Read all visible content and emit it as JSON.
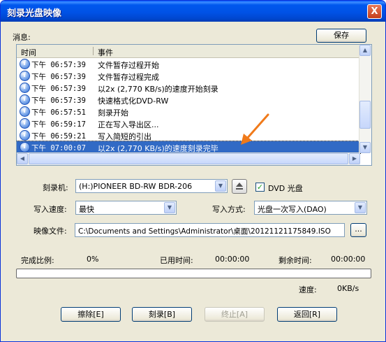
{
  "window": {
    "title": "刻录光盘映像",
    "close_label": "X"
  },
  "messages": {
    "label": "消息:",
    "save_button": "保存",
    "columns": {
      "time": "时间",
      "event": "事件"
    },
    "rows": [
      {
        "time": "下午 06:57:39",
        "event": "文件暂存过程开始"
      },
      {
        "time": "下午 06:57:39",
        "event": "文件暂存过程完成"
      },
      {
        "time": "下午 06:57:39",
        "event": "以2x (2,770 KB/s)的速度开始刻录"
      },
      {
        "time": "下午 06:57:39",
        "event": "快速格式化DVD-RW"
      },
      {
        "time": "下午 06:57:51",
        "event": "刻录开始"
      },
      {
        "time": "下午 06:59:17",
        "event": "正在写入导出区..."
      },
      {
        "time": "下午 06:59:21",
        "event": "写入简短的引出"
      },
      {
        "time": "下午 07:00:07",
        "event": "以2x (2,770 KB/s)的速度刻录完毕"
      }
    ],
    "selected_index": 7
  },
  "burner": {
    "label": "刻录机:",
    "value": "(H:)PIONEER  BD-RW   BDR-206",
    "dvd_checkbox_label": "DVD 光盘",
    "dvd_checked": true
  },
  "speed": {
    "label": "写入速度:",
    "value": "最快"
  },
  "mode": {
    "label": "写入方式:",
    "value": "光盘一次写入(DAO)"
  },
  "image": {
    "label": "映像文件:",
    "value": "C:\\Documents and Settings\\Administrator\\桌面\\20121121175849.ISO",
    "browse_label": "..."
  },
  "status": {
    "percent_label": "完成比例:",
    "percent_value": "0%",
    "elapsed_label": "已用时间:",
    "elapsed_value": "00:00:00",
    "remaining_label": "剩余时间:",
    "remaining_value": "00:00:00",
    "speed_label": "速度:",
    "speed_value": "0KB/s",
    "progress": 0
  },
  "buttons": {
    "erase": "擦除[E]",
    "burn": "刻录[B]",
    "stop": "终止[A]",
    "back": "返回[R]"
  },
  "colors": {
    "title_bar": "#0054e3",
    "selection": "#316ac5",
    "annotation_arrow": "#f07a1a"
  }
}
